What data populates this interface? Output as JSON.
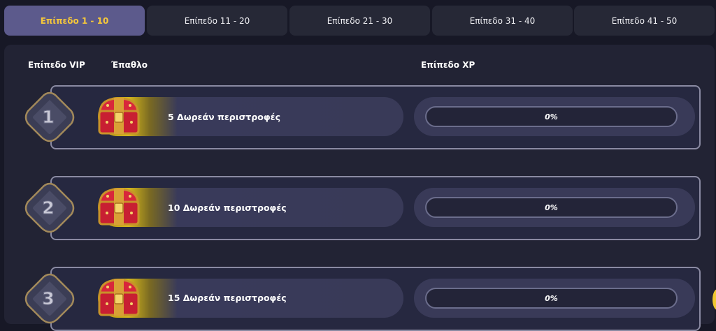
{
  "tabs": [
    {
      "label": "Επίπεδο 1 - 10",
      "active": true
    },
    {
      "label": "Επίπεδο 11 - 20",
      "active": false
    },
    {
      "label": "Επίπεδο 21 - 30",
      "active": false
    },
    {
      "label": "Επίπεδο 31 - 40",
      "active": false
    },
    {
      "label": "Επίπεδο 41 - 50",
      "active": false
    }
  ],
  "headers": {
    "vip": "Επίπεδο VIP",
    "prize": "Έπαθλο",
    "xp": "Επίπεδο XP"
  },
  "rows": [
    {
      "level": "1",
      "prize": "5 Δωρεάν περιστροφές",
      "xp": "0%"
    },
    {
      "level": "2",
      "prize": "10 Δωρεάν περιστροφές",
      "xp": "0%"
    },
    {
      "level": "3",
      "prize": "15 Δωρεάν περιστροφές",
      "xp": "0%"
    }
  ],
  "colors": {
    "accent": "#f6c83a",
    "active_tab": "#5c5a8c",
    "background": "#171826"
  },
  "icons": {
    "badge": "diamond-level-badge-icon",
    "chest": "treasure-chest-icon"
  }
}
